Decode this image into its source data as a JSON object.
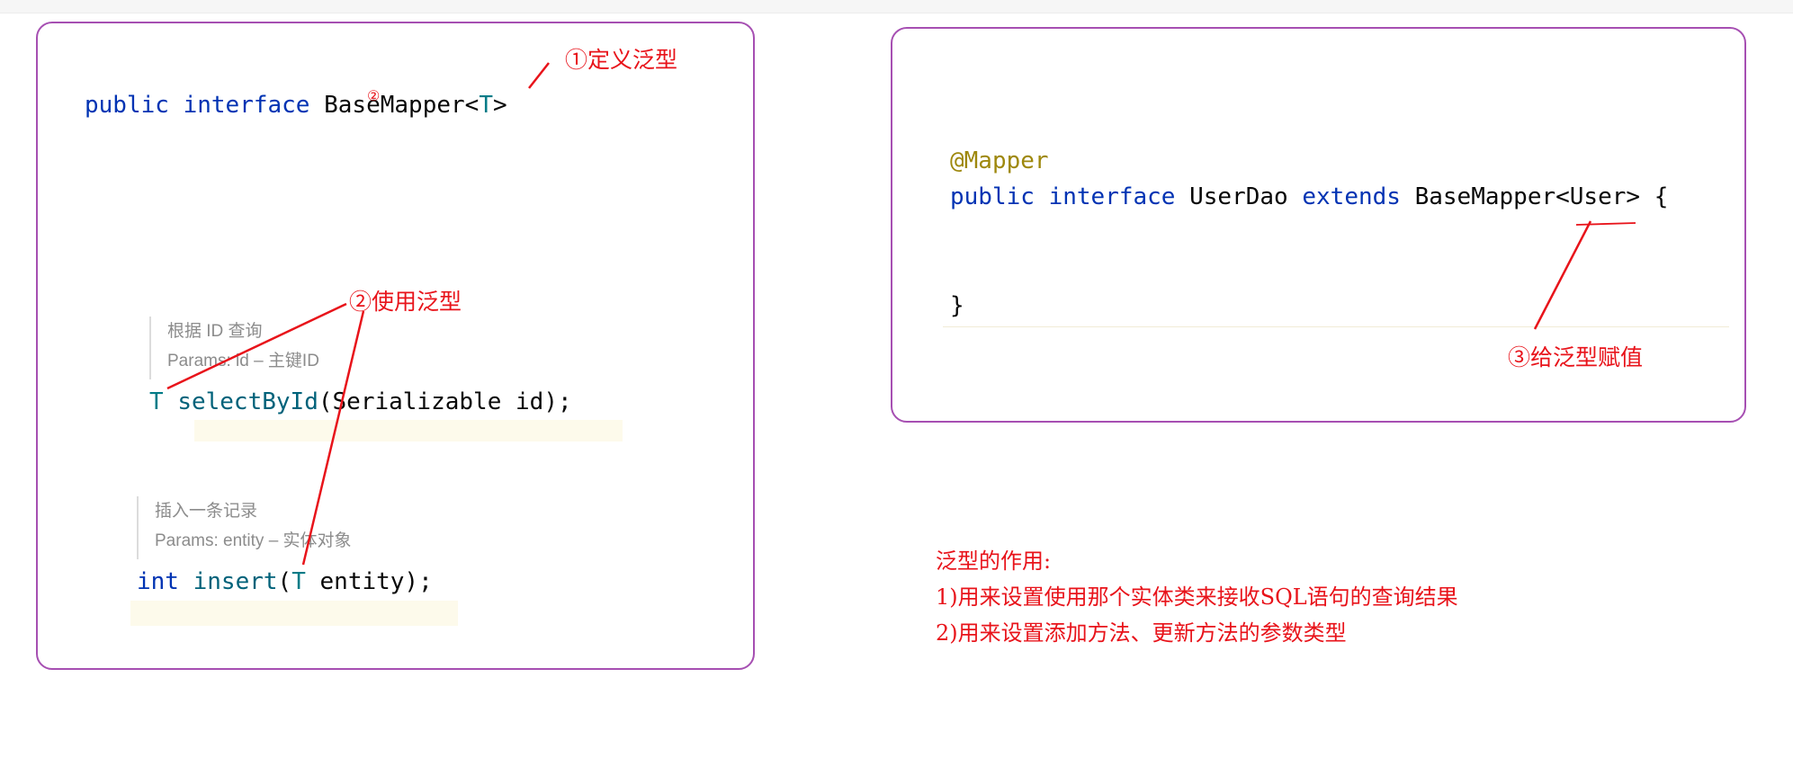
{
  "left_panel": {
    "interface_line": {
      "kw1": "public",
      "kw2": "interface",
      "name": "BaseMapper<",
      "type_param": "T",
      "close": ">"
    },
    "select_doc": {
      "line1": "根据 ID 查询",
      "line2": "Params: id – 主键ID"
    },
    "select_line": {
      "ret": "T",
      "method": "selectById",
      "rest": "(Serializable id);"
    },
    "insert_doc": {
      "line1": "插入一条记录",
      "line2": "Params: entity – 实体对象"
    },
    "insert_line": {
      "ret": "int",
      "method": "insert",
      "open": "(",
      "type_param": "T",
      "rest": " entity);"
    }
  },
  "right_panel": {
    "annotation": "@Mapper",
    "decl": {
      "kw1": "public",
      "kw2": "interface",
      "name": "UserDao",
      "kw3": "extends",
      "rest": "BaseMapper<User> {"
    },
    "closing": "}"
  },
  "labels": {
    "define": "①定义泛型",
    "use": "②使用泛型",
    "assign": "③给泛型赋值"
  },
  "notes": {
    "title": "泛型的作用:",
    "item1": "1)用来设置使用那个实体类来接收SQL语句的查询结果",
    "item2": "2)用来设置添加方法、更新方法的参数类型"
  },
  "colors": {
    "panel_border": "#a64fb2",
    "annotation_red": "#e8131a",
    "keyword_blue": "#0033b3",
    "type_teal": "#007b87",
    "annotation_olive": "#9e880d"
  }
}
